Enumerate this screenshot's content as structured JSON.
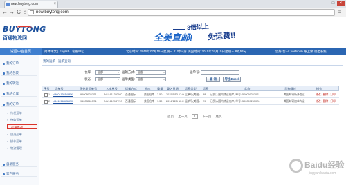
{
  "browser": {
    "tab_title": "new.buytong.com",
    "url": "new.buytong.com",
    "back_glyph": "←",
    "forward_glyph": "→",
    "reload_glyph": "C",
    "home_glyph": "⌂",
    "menu_glyph": "≡",
    "min_glyph": "–",
    "max_glyph": "□",
    "close_glyph": "×"
  },
  "site": {
    "logo_text": "BUYTONG",
    "logo_sub": "百通物流网",
    "banner_line1": "3倍以上",
    "banner_line2": "全美直邮!",
    "banner_line3": "免运费!!"
  },
  "infobar": {
    "home": "返回中台首页",
    "lang": "简体中文 | English | 客服中心",
    "center": "北京时间: 2015年07月15日星期三 21时54分   美国时间: 2015年07月15日星期三 8点54分",
    "right": "您好!客户: yoshinoh  帐上余  退出系统"
  },
  "sidebar": {
    "items": [
      {
        "label": "我的订单"
      },
      {
        "label": "我的包裹"
      },
      {
        "label": "我的转运"
      },
      {
        "label": "我的仓库"
      },
      {
        "label": "我的订单"
      },
      {
        "label": "自助服务"
      },
      {
        "label": "客户服务"
      }
    ],
    "subs": [
      {
        "label": "待发运单",
        "active": false
      },
      {
        "label": "待收运单",
        "active": false
      },
      {
        "label": "运单查询",
        "active": true
      },
      {
        "label": "自选运单",
        "active": false
      },
      {
        "label": "操作运单",
        "active": false
      },
      {
        "label": "物流管理",
        "active": false
      }
    ]
  },
  "main": {
    "breadcrumb": "我的运单 - 运单查询",
    "filters": {
      "status_label": "仓库:",
      "status_value": "全部",
      "transport_label": "运输方式:",
      "transport_value": "全部",
      "waybill_label": "运单号:",
      "origin_label": "状态:",
      "origin_value": "全部",
      "carrier_label": "运单类型:",
      "carrier_value": "全部",
      "search_button": "查 询",
      "export_button": "导出Excel"
    },
    "table": {
      "headers": [
        "序号",
        "运单号",
        "国外发运单号",
        "入库单号",
        "运输方式",
        "仓库",
        "重量",
        "录入日期",
        "运费类型",
        "运费",
        "状态",
        "货物概述",
        "操作"
      ],
      "rows": [
        {
          "index": "1",
          "waybill": "NB601138148EX",
          "foreign_no": "960089263S1",
          "storage_no": "NU161139TNC",
          "method": "百通国际",
          "warehouse": "美国仓库",
          "weight": "2.50",
          "date": "2015/1/13 17:08",
          "fee_type": "运单号(美国)",
          "fee": "38",
          "status": "已到入国内转运仓库, 单号: 5000592630S1",
          "desc": "美国邮寄新泽西运",
          "actions": "修改 | 删除 | 打印"
        },
        {
          "index": "2",
          "waybill": "NB412665658EX",
          "foreign_no": "960085615S1",
          "storage_no": "NU161218TNC",
          "method": "百通国际",
          "warehouse": "美国仓库",
          "weight": "1.30",
          "date": "2014/12/5 10:29",
          "fee_type": "运单号(美国)",
          "fee": "29",
          "status": "已到入国内转运仓库, 单号: 5000592630S1",
          "desc": "美国邮寄加拿大运",
          "actions": "修改 | 删除 | 打印"
        }
      ]
    },
    "pager": {
      "first": "首页",
      "prev": "上一页",
      "page": "1",
      "next": "下一页",
      "last": "尾页"
    }
  },
  "watermark": {
    "text": "Baidu经验",
    "sub": "jingyan.baidu.com"
  },
  "colors": {
    "brand_blue": "#2b66b2",
    "active_red": "#d9332b",
    "link_blue": "#1b4fa0"
  }
}
